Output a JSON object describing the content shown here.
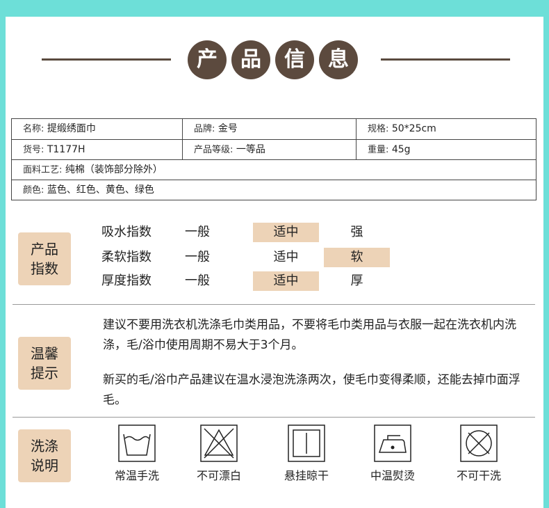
{
  "header": {
    "title_chars": [
      "产",
      "品",
      "信",
      "息"
    ]
  },
  "info": {
    "name_label": "名称:",
    "name_value": "提缎绣面巾",
    "brand_label": "品牌:",
    "brand_value": "金号",
    "spec_label": "规格:",
    "spec_value": "50*25cm",
    "sku_label": "货号:",
    "sku_value": "T1177H",
    "grade_label": "产品等级:",
    "grade_value": "一等品",
    "weight_label": "重量:",
    "weight_value": "45g",
    "material_label": "面料工艺:",
    "material_value": "纯棉（装饰部分除外）",
    "color_label": "颜色:",
    "color_value": "蓝色、红色、黄色、绿色"
  },
  "index": {
    "badge": [
      "产品",
      "指数"
    ],
    "rows": [
      {
        "name": "吸水指数",
        "options": [
          "一般",
          "适中",
          "强"
        ],
        "selected": 1
      },
      {
        "name": "柔软指数",
        "options": [
          "一般",
          "适中",
          "软"
        ],
        "selected": 2
      },
      {
        "name": "厚度指数",
        "options": [
          "一般",
          "适中",
          "厚"
        ],
        "selected": 1
      }
    ]
  },
  "tips": {
    "badge": [
      "温馨",
      "提示"
    ],
    "p1": "建议不要用洗衣机洗涤毛巾类用品，不要将毛巾类用品与衣服一起在洗衣机内洗涤，毛/浴巾使用周期不易大于3个月。",
    "p2": "新买的毛/浴巾产品建议在温水浸泡洗涤两次，使毛巾变得柔顺，还能去掉巾面浮毛。"
  },
  "wash": {
    "badge": [
      "洗涤",
      "说明"
    ],
    "items": [
      {
        "icon": "hand-wash-icon",
        "label": "常温手洗"
      },
      {
        "icon": "no-bleach-icon",
        "label": "不可漂白"
      },
      {
        "icon": "hang-dry-icon",
        "label": "悬挂晾干"
      },
      {
        "icon": "iron-medium-icon",
        "label": "中温熨烫"
      },
      {
        "icon": "no-dry-clean-icon",
        "label": "不可干洗"
      }
    ]
  },
  "colors": {
    "background": "#6ddfd8",
    "circle": "#5c4a3e",
    "highlight": "#edd3b7"
  }
}
